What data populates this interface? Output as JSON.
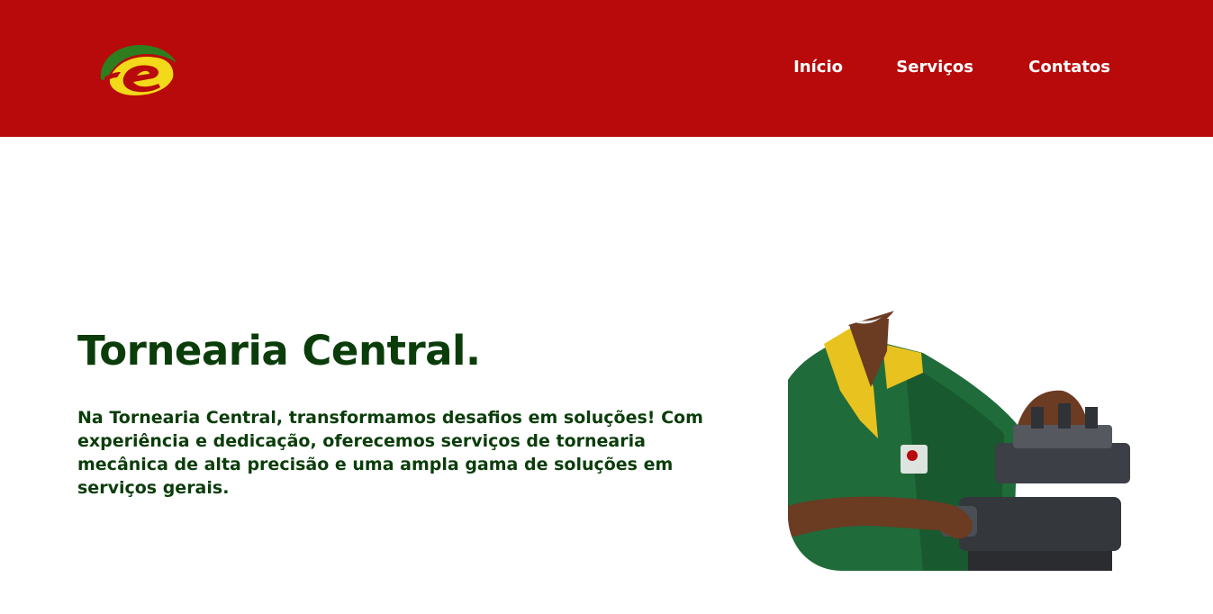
{
  "header": {
    "background_color": "#b80a0a",
    "logo": {
      "icon": "tc-logo-icon",
      "colors": {
        "leaf": "#2e7d1e",
        "swoosh": "#f2d91a",
        "letter": "#b80a0a"
      }
    },
    "nav": {
      "items": [
        {
          "label": "Início"
        },
        {
          "label": "Serviços"
        },
        {
          "label": "Contatos"
        }
      ]
    }
  },
  "hero": {
    "title": "Tornearia Central.",
    "description": "Na Tornearia Central, transformamos desafios em soluções! Com experiência e dedicação, oferecemos serviços de tornearia mecânica de alta precisão e uma ampla gama de soluções em serviços gerais.",
    "text_color": "#0b3d0b",
    "photo": {
      "icon": "machinist-photo",
      "colors": {
        "shirt": "#1f6b3a",
        "collar": "#e8c21e",
        "skin": "#6b3b22",
        "machine": "#3c3f45"
      }
    }
  }
}
